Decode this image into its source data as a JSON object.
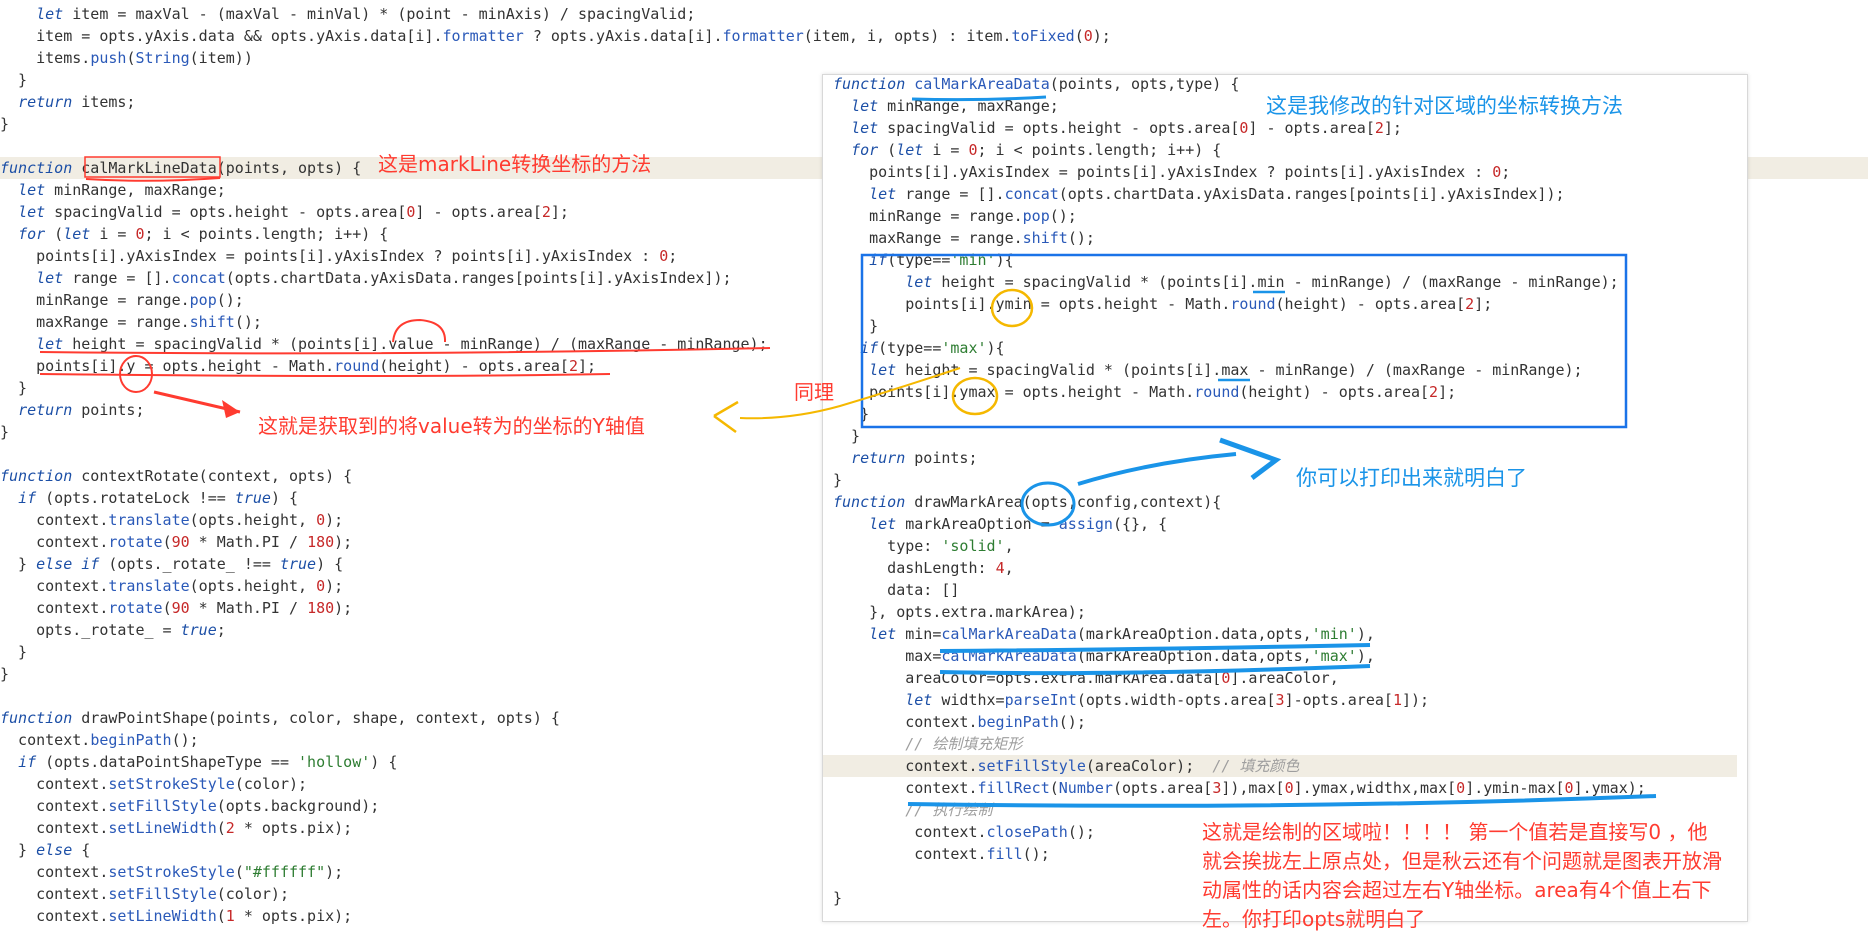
{
  "left_code": [
    "    let item = maxVal - (maxVal - minVal) * (point - minAxis) / spacingValid;",
    "    item = opts.yAxis.data && opts.yAxis.data[i].formatter ? opts.yAxis.data[i].formatter(item, i, opts) : item.toFixed(0);",
    "    items.push(String(item))",
    "  }",
    "  return items;",
    "}",
    "",
    "function calMarkLineData(points, opts) {",
    "  let minRange, maxRange;",
    "  let spacingValid = opts.height - opts.area[0] - opts.area[2];",
    "  for (let i = 0; i < points.length; i++) {",
    "    points[i].yAxisIndex = points[i].yAxisIndex ? points[i].yAxisIndex : 0;",
    "    let range = [].concat(opts.chartData.yAxisData.ranges[points[i].yAxisIndex]);",
    "    minRange = range.pop();",
    "    maxRange = range.shift();",
    "    let height = spacingValid * (points[i].value - minRange) / (maxRange - minRange);",
    "    points[i].y = opts.height - Math.round(height) - opts.area[2];",
    "  }",
    "  return points;",
    "}",
    "",
    "function contextRotate(context, opts) {",
    "  if (opts.rotateLock !== true) {",
    "    context.translate(opts.height, 0);",
    "    context.rotate(90 * Math.PI / 180);",
    "  } else if (opts._rotate_ !== true) {",
    "    context.translate(opts.height, 0);",
    "    context.rotate(90 * Math.PI / 180);",
    "    opts._rotate_ = true;",
    "  }",
    "}",
    "",
    "function drawPointShape(points, color, shape, context, opts) {",
    "  context.beginPath();",
    "  if (opts.dataPointShapeType == 'hollow') {",
    "    context.setStrokeStyle(color);",
    "    context.setFillStyle(opts.background);",
    "    context.setLineWidth(2 * opts.pix);",
    "  } else {",
    "    context.setStrokeStyle(\"#ffffff\");",
    "    context.setFillStyle(color);",
    "    context.setLineWidth(1 * opts.pix);"
  ],
  "right_code": [
    "function calMarkAreaData(points, opts,type) {",
    "  let minRange, maxRange;",
    "  let spacingValid = opts.height - opts.area[0] - opts.area[2];",
    "  for (let i = 0; i < points.length; i++) {",
    "    points[i].yAxisIndex = points[i].yAxisIndex ? points[i].yAxisIndex : 0;",
    "    let range = [].concat(opts.chartData.yAxisData.ranges[points[i].yAxisIndex]);",
    "    minRange = range.pop();",
    "    maxRange = range.shift();",
    "    if(type=='min'){",
    "        let height = spacingValid * (points[i].min - minRange) / (maxRange - minRange);",
    "        points[i].ymin = opts.height - Math.round(height) - opts.area[2];",
    "    }",
    "   if(type=='max'){",
    "    let height = spacingValid * (points[i].max - minRange) / (maxRange - minRange);",
    "    points[i].ymax = opts.height - Math.round(height) - opts.area[2];",
    "   }",
    "  }",
    "  return points;",
    "}",
    "function drawMarkArea(opts,config,context){",
    "    let markAreaOption = assign({}, {",
    "      type: 'solid',",
    "      dashLength: 4,",
    "      data: []",
    "    }, opts.extra.markArea);",
    "    let min=calMarkAreaData(markAreaOption.data,opts,'min'),",
    "        max=calMarkAreaData(markAreaOption.data,opts,'max'),",
    "        areaColor=opts.extra.markArea.data[0].areaColor,",
    "        let widthx=parseInt(opts.width-opts.area[3]-opts.area[1]);",
    "        context.beginPath();",
    "        // 绘制填充矩形",
    "        context.setFillStyle(areaColor);  // 填充颜色",
    "        context.fillRect(Number(opts.area[3]),max[0].ymax,widthx,max[0].ymin-max[0].ymax);",
    "        // 执行绘制",
    "         context.closePath();",
    "         context.fill();",
    "",
    "}"
  ],
  "annotations": {
    "markline_method": "这是markLine转换坐标的方法",
    "value_to_y": "这就是获取到的将value转为的坐标的Y轴值",
    "same_logic": "同理",
    "modified_method": "这是我修改的针对区域的坐标转换方法",
    "print_hint": "你可以打印出来就明白了",
    "draw_area_note": "这就是绘制的区域啦！！！！ 第一个值若是直接写0 ，他就会挨拢左上原点处，但是秋云还有个问题就是图表开放滑动属性的话内容会超过左右Y轴坐标。area有4个值上右下左。你打印opts就明白了"
  },
  "colors": {
    "annotation_red": "#ff3b30",
    "annotation_blue": "#1a94e8",
    "annotation_yellow": "#f5b800",
    "keyword": "#1c4fa6",
    "string": "#2e7d32",
    "number": "#c62828"
  }
}
